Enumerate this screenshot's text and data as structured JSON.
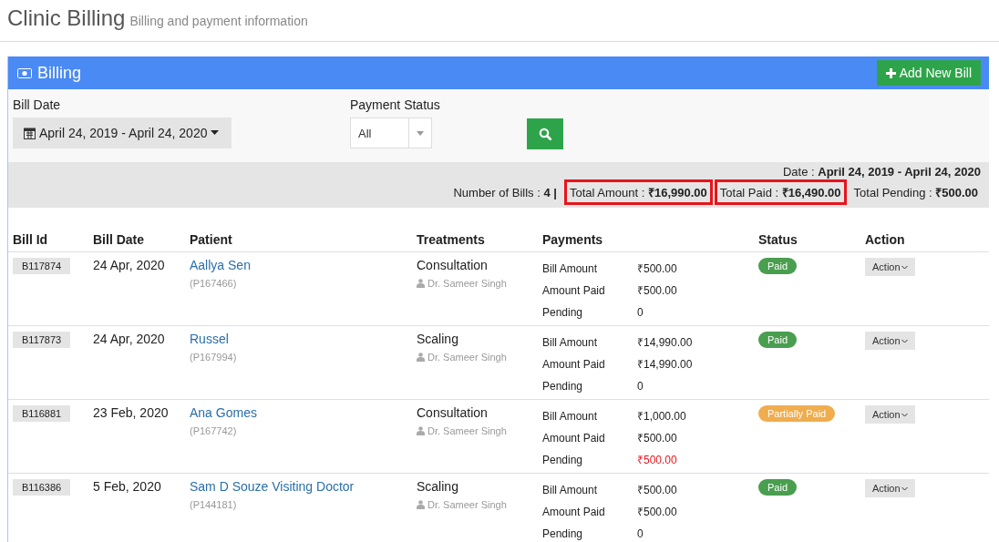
{
  "page": {
    "title": "Clinic Billing",
    "subtitle": "Billing and payment information"
  },
  "panel": {
    "title": "Billing",
    "add_button": "Add New Bill"
  },
  "filters": {
    "bill_date": {
      "label": "Bill Date",
      "value": "April 24, 2019 - April 24, 2020"
    },
    "payment_status": {
      "label": "Payment Status",
      "value": "All"
    }
  },
  "summary": {
    "date_label": "Date :",
    "date_value": "April 24, 2019 - April 24, 2020",
    "items": [
      {
        "label": "Number of Bills :",
        "value": "4",
        "separator": "|",
        "highlighted": false
      },
      {
        "label": "Total Amount :",
        "value": "₹16,990.00",
        "highlighted": true
      },
      {
        "label": "Total Paid :",
        "value": "₹16,490.00",
        "highlighted": true
      },
      {
        "label": "Total Pending :",
        "value": "₹500.00",
        "highlighted": false
      }
    ]
  },
  "table": {
    "columns": [
      "Bill Id",
      "Bill Date",
      "Patient",
      "Treatments",
      "Payments",
      "Status",
      "Action"
    ],
    "rows": [
      {
        "bill_id": "B117874",
        "date": "24 Apr, 2020",
        "patient": "Aallya Sen",
        "patient_id": "(P167466)",
        "treatment": "Consultation",
        "doctor": "Dr. Sameer Singh",
        "payments": [
          {
            "label": "Bill Amount",
            "value": "₹500.00",
            "due": false
          },
          {
            "label": "Amount Paid",
            "value": "₹500.00",
            "due": false
          },
          {
            "label": "Pending",
            "value": "0",
            "due": false
          }
        ],
        "status": "Paid",
        "color": "#4a9e4f",
        "action": "Action"
      },
      {
        "bill_id": "B117873",
        "date": "24 Apr, 2020",
        "patient": "Russel",
        "patient_id": "(P167994)",
        "treatment": "Scaling",
        "doctor": "Dr. Sameer Singh",
        "payments": [
          {
            "label": "Bill Amount",
            "value": "₹14,990.00",
            "due": false
          },
          {
            "label": "Amount Paid",
            "value": "₹14,990.00",
            "due": false
          },
          {
            "label": "Pending",
            "value": "0",
            "due": false
          }
        ],
        "status": "Paid",
        "color": "#4a9e4f",
        "action": "Action"
      },
      {
        "bill_id": "B116881",
        "date": "23 Feb, 2020",
        "patient": "Ana Gomes",
        "patient_id": "(P167742)",
        "treatment": "Consultation",
        "doctor": "Dr. Sameer Singh",
        "payments": [
          {
            "label": "Bill Amount",
            "value": "₹1,000.00",
            "due": false
          },
          {
            "label": "Amount Paid",
            "value": "₹500.00",
            "due": false
          },
          {
            "label": "Pending",
            "value": "₹500.00",
            "due": true
          }
        ],
        "status": "Partially Paid",
        "color": "#f0ad4e",
        "action": "Action"
      },
      {
        "bill_id": "B116386",
        "date": "5 Feb, 2020",
        "patient": "Sam D Souze Visiting Doctor",
        "patient_id": "(P144181)",
        "treatment": "Scaling",
        "doctor": "Dr. Sameer Singh",
        "payments": [
          {
            "label": "Bill Amount",
            "value": "₹500.00",
            "due": false
          },
          {
            "label": "Amount Paid",
            "value": "₹500.00",
            "due": false
          },
          {
            "label": "Pending",
            "value": "0",
            "due": false
          }
        ],
        "status": "Paid",
        "color": "#4a9e4f",
        "action": "Action"
      }
    ]
  }
}
